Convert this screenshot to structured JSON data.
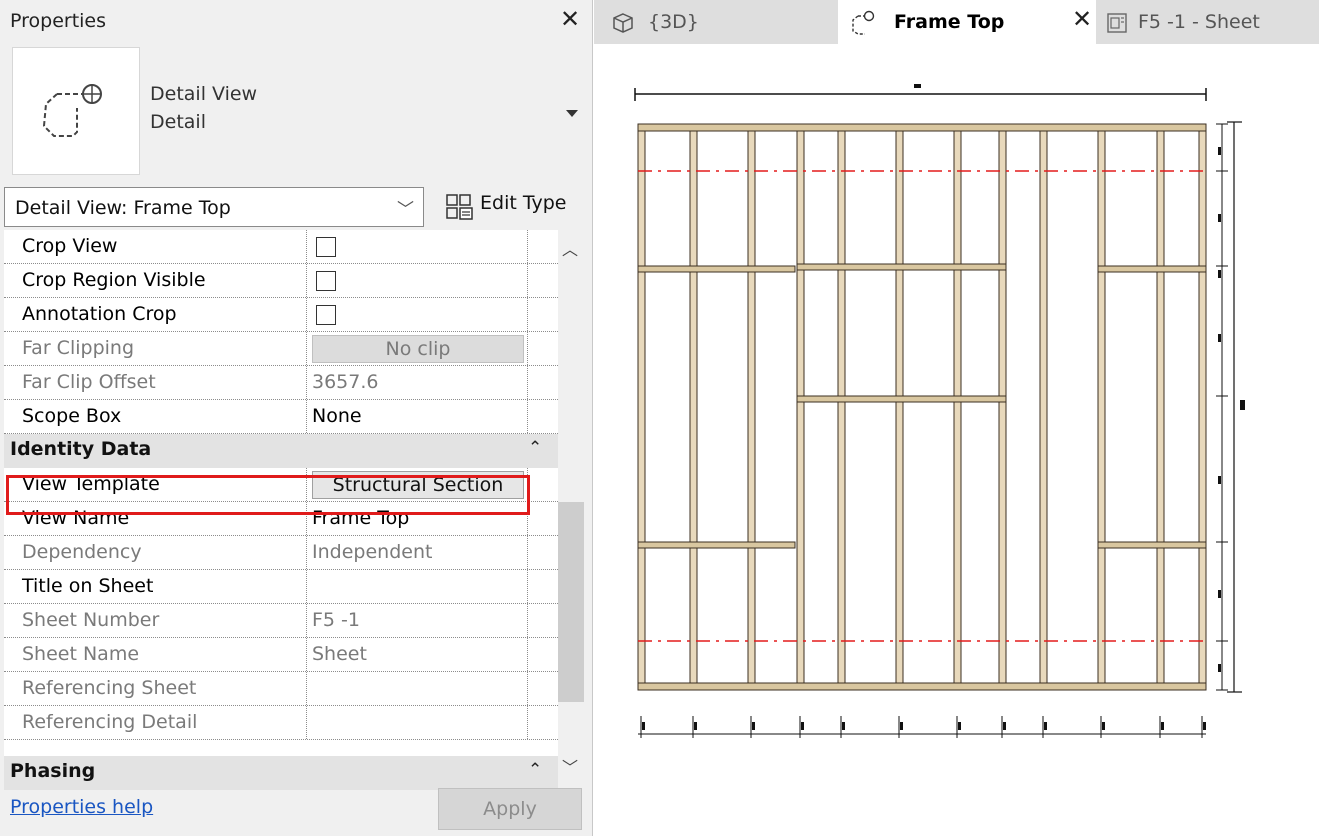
{
  "properties": {
    "title": "Properties",
    "type_name_line1": "Detail View",
    "type_name_line2": "Detail",
    "instance_selector": "Detail View: Frame Top",
    "edit_type_label": "Edit Type",
    "rows": {
      "crop_view": {
        "name": "Crop View"
      },
      "crop_region_visible": {
        "name": "Crop Region Visible"
      },
      "annotation_crop": {
        "name": "Annotation Crop"
      },
      "far_clipping": {
        "name": "Far Clipping",
        "value": "No clip"
      },
      "far_clip_offset": {
        "name": "Far Clip Offset",
        "value": "3657.6"
      },
      "scope_box": {
        "name": "Scope Box",
        "value": "None"
      },
      "view_template": {
        "name": "View Template",
        "value": "Structural Section"
      },
      "view_name": {
        "name": "View Name",
        "value": "Frame Top"
      },
      "dependency": {
        "name": "Dependency",
        "value": "Independent"
      },
      "title_on_sheet": {
        "name": "Title on Sheet",
        "value": ""
      },
      "sheet_number": {
        "name": "Sheet Number",
        "value": "F5 -1"
      },
      "sheet_name": {
        "name": "Sheet Name",
        "value": "Sheet"
      },
      "referencing_sheet": {
        "name": "Referencing Sheet",
        "value": ""
      },
      "referencing_detail": {
        "name": "Referencing Detail",
        "value": ""
      }
    },
    "groups": {
      "identity_data": "Identity Data",
      "phasing": "Phasing"
    },
    "help_link": "Properties help",
    "apply_label": "Apply",
    "highlight_color": "#e01b1b"
  },
  "tabs": [
    {
      "label": "{3D}",
      "active": false
    },
    {
      "label": "Frame Top",
      "active": true
    },
    {
      "label": "F5 -1 - Sheet",
      "active": false
    }
  ],
  "colors": {
    "lumber_fill": "#e8d9bc",
    "lumber_edge": "#3b2f22",
    "plate_fill": "#d9c7a0",
    "reference_line": "#e31b1b"
  }
}
